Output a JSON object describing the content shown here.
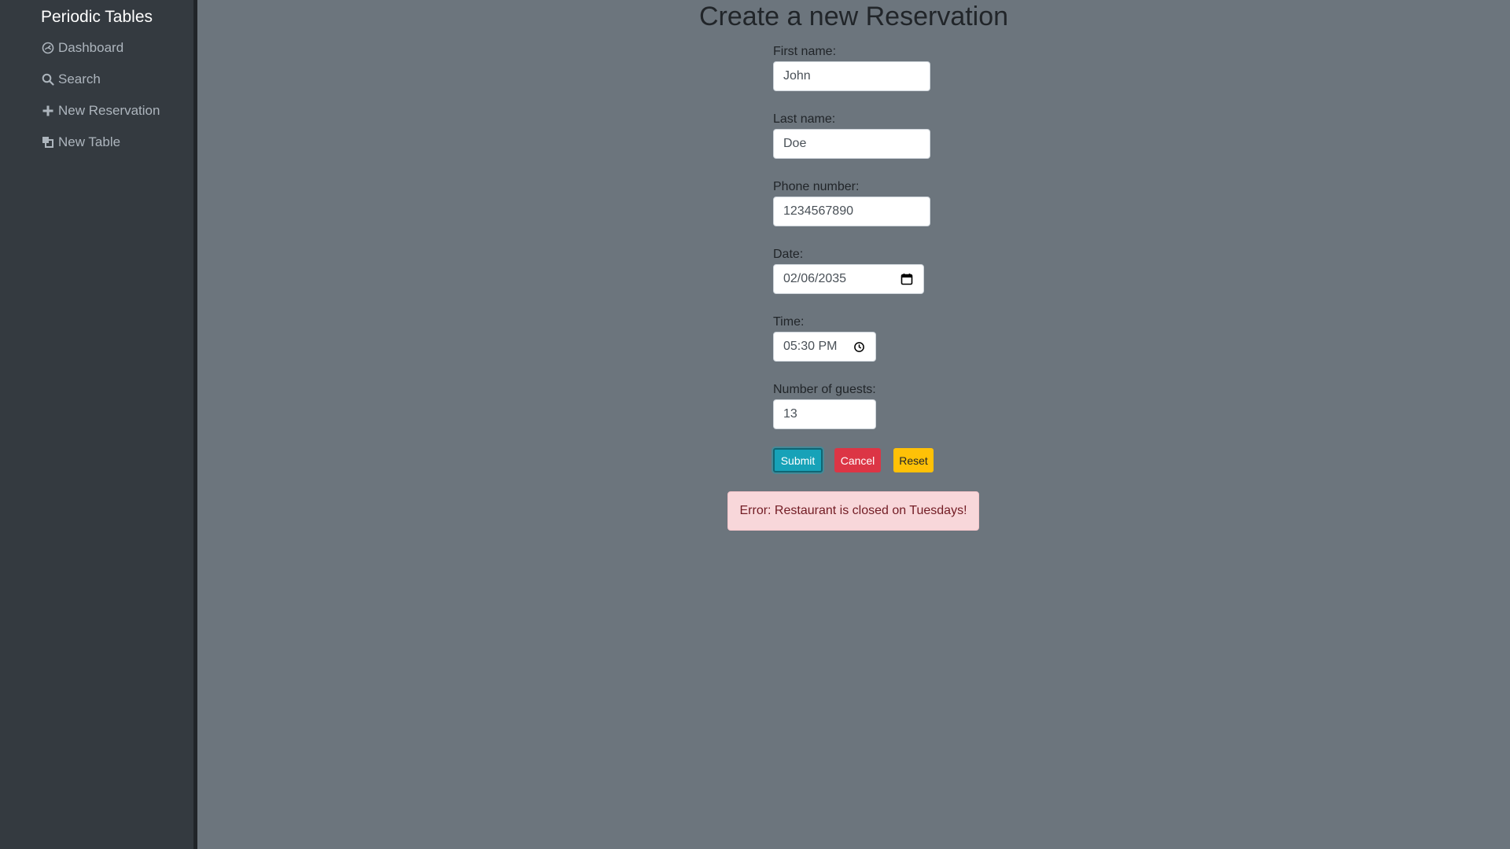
{
  "sidebar": {
    "brand": "Periodic Tables",
    "items": [
      {
        "label": "Dashboard",
        "icon": "dashboard-icon"
      },
      {
        "label": "Search",
        "icon": "search-icon"
      },
      {
        "label": "New Reservation",
        "icon": "plus-icon"
      },
      {
        "label": "New Table",
        "icon": "layers-icon"
      }
    ]
  },
  "main": {
    "title": "Create a new Reservation",
    "form": {
      "first_name": {
        "label": "First name:",
        "value": "John"
      },
      "last_name": {
        "label": "Last name:",
        "value": "Doe"
      },
      "phone": {
        "label": "Phone number:",
        "value": "1234567890"
      },
      "date": {
        "label": "Date:",
        "value": "02/06/2035"
      },
      "time": {
        "label": "Time:",
        "value": "05:30 PM"
      },
      "guests": {
        "label": "Number of guests:",
        "value": "13"
      }
    },
    "buttons": {
      "submit": "Submit",
      "cancel": "Cancel",
      "reset": "Reset"
    },
    "error": "Error: Restaurant is closed on Tuesdays!"
  },
  "colors": {
    "sidebar_bg": "#343a40",
    "main_bg": "#6c757d",
    "submit": "#17a2b8",
    "cancel": "#dc3545",
    "reset": "#ffc107",
    "alert_bg": "#f8d7da",
    "alert_text": "#721c24"
  }
}
